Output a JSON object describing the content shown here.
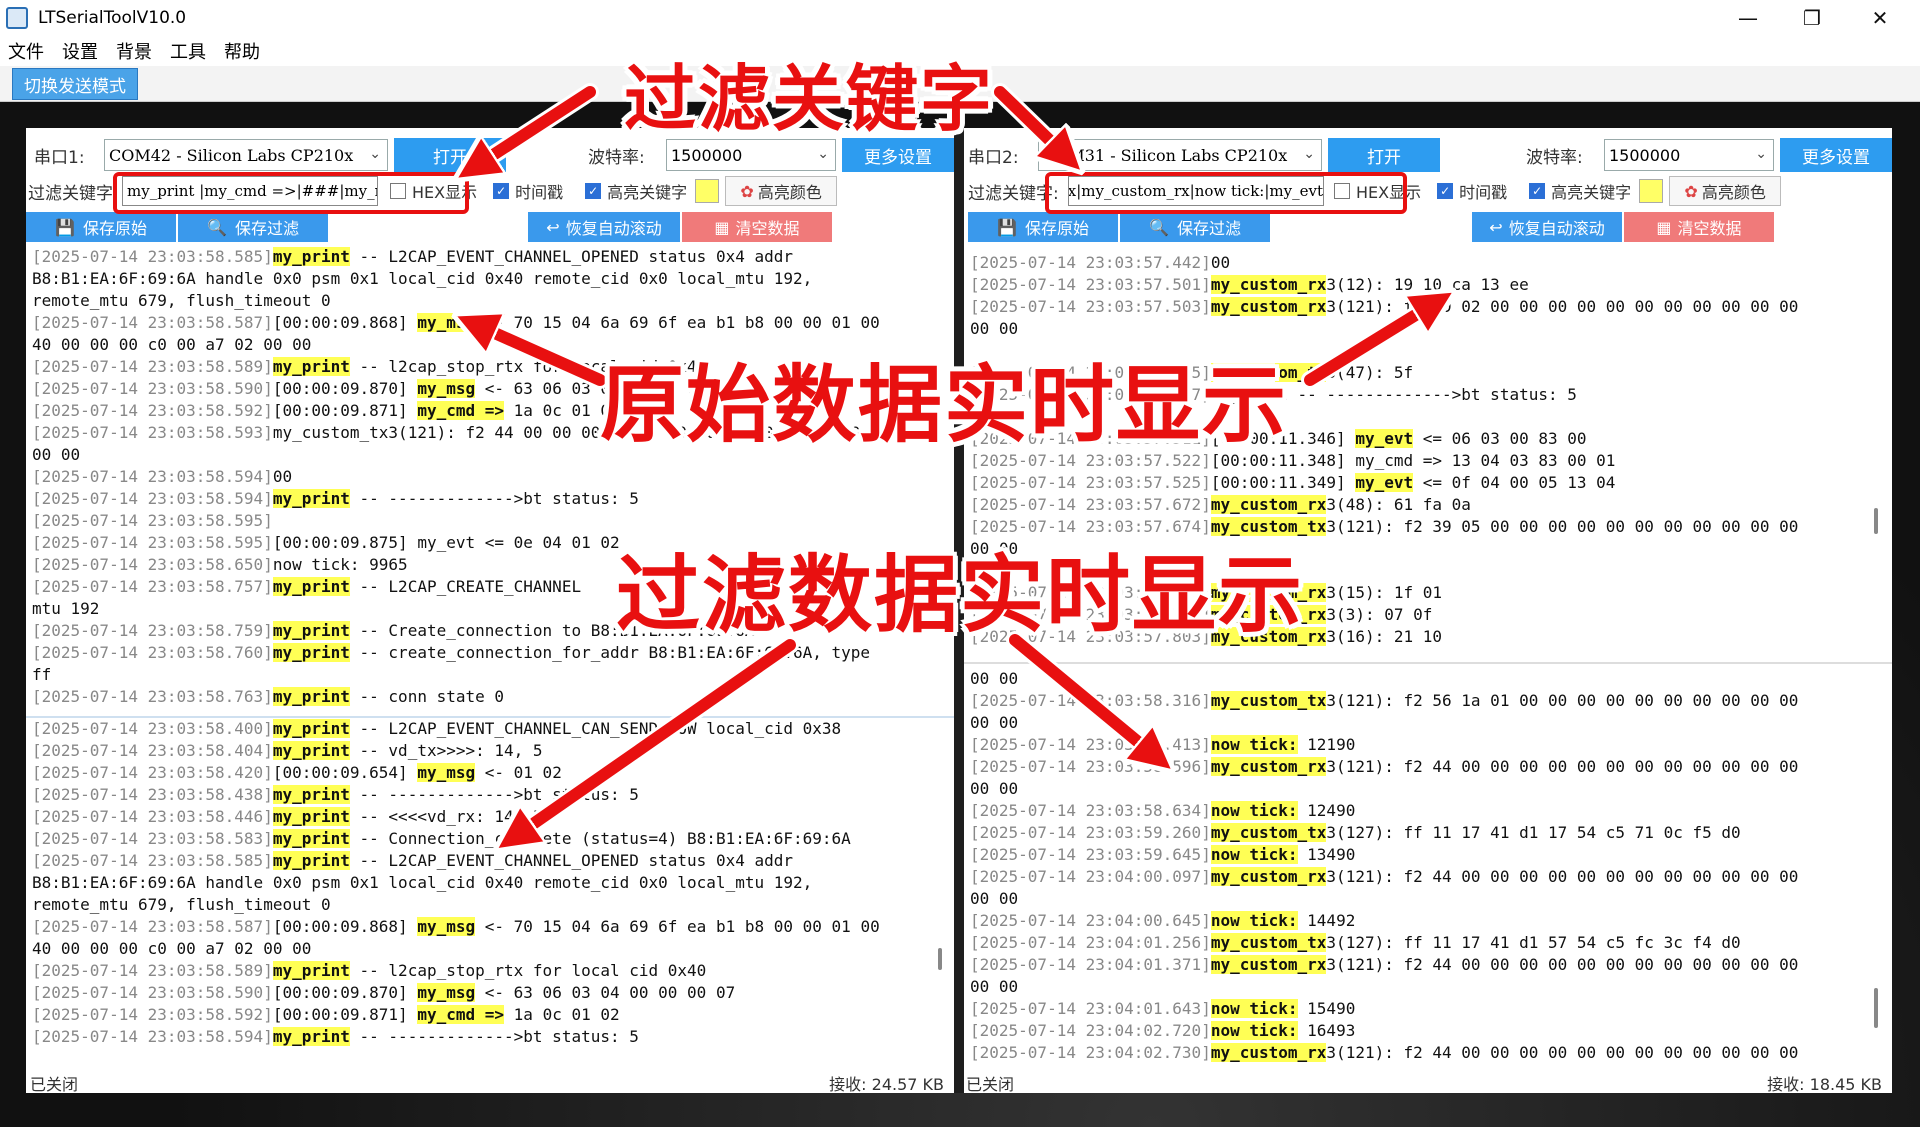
{
  "window": {
    "title": "LTSerialToolV10.0",
    "minimize": "—",
    "maximize": "❐",
    "close": "✕"
  },
  "menu": [
    "文件",
    "设置",
    "背景",
    "工具",
    "帮助"
  ],
  "toolbar": {
    "switch_mode": "切换发送模式"
  },
  "left": {
    "port_label": "串口1:",
    "port_value": "COM42 - Silicon Labs CP210x",
    "open_button": "打开",
    "baud_label": "波特率:",
    "baud_value": "1500000",
    "more_settings": "更多设置",
    "filter_label": "过滤关键字:",
    "filter_value": "my_print |my_cmd =>|###|my_msg",
    "hex_label": "HEX显示",
    "timestamp_label": "时间戳",
    "highlight_label": "高亮关键字",
    "highlight_color_button": "高亮颜色",
    "save_raw": "保存原始",
    "save_filtered": "保存过滤",
    "resume_scroll": "恢复自动滚动",
    "clear_data": "清空数据",
    "status_left": "已关闭",
    "status_right": "接收: 24.57 KB",
    "raw_lines": [
      [
        {
          "t": "[2025-07-14 23:03:58.585]",
          "c": "ts"
        },
        {
          "t": "my_print",
          "c": "hl"
        },
        {
          "t": " -- L2CAP_EVENT_CHANNEL_OPENED status 0x4 addr"
        }
      ],
      [
        {
          "t": "B8:B1:EA:6F:69:6A handle 0x0 psm 0x1 local_cid 0x40 remote_cid 0x0 local_mtu 192,"
        }
      ],
      [
        {
          "t": "remote_mtu 679, flush_timeout 0"
        }
      ],
      [
        {
          "t": "[2025-07-14 23:03:58.587]",
          "c": "ts"
        },
        {
          "t": "[00:00:09.868] "
        },
        {
          "t": "my_msg",
          "c": "hl"
        },
        {
          "t": " <- 70 15 04 6a 69 6f ea b1 b8 00 00 01 00"
        }
      ],
      [
        {
          "t": "40 00 00 00 c0 00 a7 02 00 00"
        }
      ],
      [
        {
          "t": "[2025-07-14 23:03:58.589]",
          "c": "ts"
        },
        {
          "t": "my_print",
          "c": "hl"
        },
        {
          "t": " -- l2cap_stop_rtx for local cid 0x40"
        }
      ],
      [
        {
          "t": "[2025-07-14 23:03:58.590]",
          "c": "ts"
        },
        {
          "t": "[00:00:09.870] "
        },
        {
          "t": "my_msg",
          "c": "hl"
        },
        {
          "t": " <- 63 06 03 04 00 00 00 07"
        }
      ],
      [
        {
          "t": "[2025-07-14 23:03:58.592]",
          "c": "ts"
        },
        {
          "t": "[00:00:09.871] "
        },
        {
          "t": "my_cmd =>",
          "c": "hl"
        },
        {
          "t": " 1a 0c 01 02"
        }
      ],
      [
        {
          "t": "[2025-07-14 23:03:58.593]",
          "c": "ts"
        },
        {
          "t": "my_custom_tx3(121): f2 44 00 00 00 00 00 00 00 00 00 00 00 00"
        }
      ],
      [
        {
          "t": "00 00"
        }
      ],
      [
        {
          "t": "[2025-07-14 23:03:58.594]",
          "c": "ts"
        },
        {
          "t": "00"
        }
      ],
      [
        {
          "t": "[2025-07-14 23:03:58.594]",
          "c": "ts"
        },
        {
          "t": "my_print",
          "c": "hl"
        },
        {
          "t": " -- ------------->bt status: 5"
        }
      ],
      [
        {
          "t": "[2025-07-14 23:03:58.595]",
          "c": "ts"
        }
      ],
      [
        {
          "t": "[2025-07-14 23:03:58.595]",
          "c": "ts"
        },
        {
          "t": "[00:00:09.875] my_evt <= 0e 04 01 02"
        }
      ],
      [
        {
          "t": "[2025-07-14 23:03:58.650]",
          "c": "ts"
        },
        {
          "t": "now tick: 9965"
        }
      ],
      [
        {
          "t": "[2025-07-14 23:03:58.757]",
          "c": "ts"
        },
        {
          "t": "my_print",
          "c": "hl"
        },
        {
          "t": " -- L2CAP_CREATE_CHANNEL"
        }
      ],
      [
        {
          "t": "mtu 192"
        }
      ],
      [
        {
          "t": "[2025-07-14 23:03:58.759]",
          "c": "ts"
        },
        {
          "t": "my_print",
          "c": "hl"
        },
        {
          "t": " -- Create_connection to B8:B1:EA:6F:69:6A"
        }
      ],
      [
        {
          "t": "[2025-07-14 23:03:58.760]",
          "c": "ts"
        },
        {
          "t": "my_print",
          "c": "hl"
        },
        {
          "t": " -- create_connection_for_addr B8:B1:EA:6F:69:6A, type"
        }
      ],
      [
        {
          "t": "ff"
        }
      ],
      [
        {
          "t": "[2025-07-14 23:03:58.763]",
          "c": "ts"
        },
        {
          "t": "my_print",
          "c": "hl"
        },
        {
          "t": " -- conn state 0"
        }
      ]
    ],
    "filtered_lines": [
      [
        {
          "t": "[2025-07-14 23:03:58.400]",
          "c": "ts"
        },
        {
          "t": "my_print",
          "c": "hl"
        },
        {
          "t": " -- L2CAP_EVENT_CHANNEL_CAN_SEND_NOW local_cid 0x38"
        }
      ],
      [
        {
          "t": "[2025-07-14 23:03:58.404]",
          "c": "ts"
        },
        {
          "t": "my_print",
          "c": "hl"
        },
        {
          "t": " -- vd_tx>>>>: 14, 5"
        }
      ],
      [
        {
          "t": "[2025-07-14 23:03:58.420]",
          "c": "ts"
        },
        {
          "t": "[00:00:09.654] "
        },
        {
          "t": "my_msg",
          "c": "hl"
        },
        {
          "t": " <- 01 02"
        }
      ],
      [
        {
          "t": "[2025-07-14 23:03:58.438]",
          "c": "ts"
        },
        {
          "t": "my_print",
          "c": "hl"
        },
        {
          "t": " -- ------------->bt status: 5"
        }
      ],
      [
        {
          "t": "[2025-07-14 23:03:58.446]",
          "c": "ts"
        },
        {
          "t": "my_print",
          "c": "hl"
        },
        {
          "t": " -- <<<<vd_rx: 14, 5"
        }
      ],
      [
        {
          "t": "[2025-07-14 23:03:58.583]",
          "c": "ts"
        },
        {
          "t": "my_print",
          "c": "hl"
        },
        {
          "t": " -- Connection_complete (status=4) B8:B1:EA:6F:69:6A"
        }
      ],
      [
        {
          "t": "[2025-07-14 23:03:58.585]",
          "c": "ts"
        },
        {
          "t": "my_print",
          "c": "hl"
        },
        {
          "t": " -- L2CAP_EVENT_CHANNEL_OPENED status 0x4 addr"
        }
      ],
      [
        {
          "t": "B8:B1:EA:6F:69:6A handle 0x0 psm 0x1 local_cid 0x40 remote_cid 0x0 local_mtu 192,"
        }
      ],
      [
        {
          "t": "remote_mtu 679, flush_timeout 0"
        }
      ],
      [
        {
          "t": "[2025-07-14 23:03:58.587]",
          "c": "ts"
        },
        {
          "t": "[00:00:09.868] "
        },
        {
          "t": "my_msg",
          "c": "hl"
        },
        {
          "t": " <- 70 15 04 6a 69 6f ea b1 b8 00 00 01 00"
        }
      ],
      [
        {
          "t": "40 00 00 00 c0 00 a7 02 00 00"
        }
      ],
      [
        {
          "t": "[2025-07-14 23:03:58.589]",
          "c": "ts"
        },
        {
          "t": "my_print",
          "c": "hl"
        },
        {
          "t": " -- l2cap_stop_rtx for local cid 0x40"
        }
      ],
      [
        {
          "t": "[2025-07-14 23:03:58.590]",
          "c": "ts"
        },
        {
          "t": "[00:00:09.870] "
        },
        {
          "t": "my_msg",
          "c": "hl"
        },
        {
          "t": " <- 63 06 03 04 00 00 00 07"
        }
      ],
      [
        {
          "t": "[2025-07-14 23:03:58.592]",
          "c": "ts"
        },
        {
          "t": "[00:00:09.871] "
        },
        {
          "t": "my_cmd =>",
          "c": "hl"
        },
        {
          "t": " 1a 0c 01 02"
        }
      ],
      [
        {
          "t": "[2025-07-14 23:03:58.594]",
          "c": "ts"
        },
        {
          "t": "my_print",
          "c": "hl"
        },
        {
          "t": " -- ------------->bt status: 5"
        }
      ]
    ]
  },
  "right": {
    "port_label": "串口2:",
    "port_value": "COM31 - Silicon Labs CP210x",
    "open_button": "打开",
    "baud_label": "波特率:",
    "baud_value": "1500000",
    "more_settings": "更多设置",
    "filter_label": "过滤关键字:",
    "filter_value": "my_custom_tx|my_custom_rx|now tick:|my_evt",
    "hex_label": "HEX显示",
    "timestamp_label": "时间戳",
    "highlight_label": "高亮关键字",
    "highlight_color_button": "高亮颜色",
    "save_raw": "保存原始",
    "save_filtered": "保存过滤",
    "resume_scroll": "恢复自动滚动",
    "clear_data": "清空数据",
    "status_left": "已关闭",
    "status_right": "接收: 18.45 KB",
    "raw_lines": [
      [
        {
          "t": "[2025-07-14 23:03:57.442]",
          "c": "ts"
        },
        {
          "t": "00"
        }
      ],
      [
        {
          "t": "[2025-07-14 23:03:57.501]",
          "c": "ts"
        },
        {
          "t": "my_custom_rx",
          "c": "hl"
        },
        {
          "t": "3(12): 19 10 ca 13 ee"
        }
      ],
      [
        {
          "t": "[2025-07-14 23:03:57.503]",
          "c": "ts"
        },
        {
          "t": "my_custom_rx",
          "c": "hl"
        },
        {
          "t": "3(121): f2 39 02 00 00 00 00 00 00 00 00 00 00 00"
        }
      ],
      [
        {
          "t": "00 00"
        }
      ],
      [
        {
          "t": ""
        }
      ],
      [
        {
          "t": "[2025-07-14 23:03:57.505]",
          "c": "ts"
        },
        {
          "t": "my_custom_tx",
          "c": "hl"
        },
        {
          "t": "3(47): 5f"
        }
      ],
      [
        {
          "t": "[2025-07-14 23:03:57.507]",
          "c": "ts"
        },
        {
          "t": "my_print -- ------------->bt status: 5"
        }
      ],
      [
        {
          "t": ""
        }
      ],
      [
        {
          "t": "[2025-07-14 23:03:57.511]",
          "c": "ts"
        },
        {
          "t": "[00:00:11.346] "
        },
        {
          "t": "my_evt",
          "c": "hl"
        },
        {
          "t": " <= 06 03 00 83 00"
        }
      ],
      [
        {
          "t": "[2025-07-14 23:03:57.522]",
          "c": "ts"
        },
        {
          "t": "[00:00:11.348] my_cmd => 13 04 03 83 00 01"
        }
      ],
      [
        {
          "t": "[2025-07-14 23:03:57.525]",
          "c": "ts"
        },
        {
          "t": "[00:00:11.349] "
        },
        {
          "t": "my_evt",
          "c": "hl"
        },
        {
          "t": " <= 0f 04 00 05 13 04"
        }
      ],
      [
        {
          "t": "[2025-07-14 23:03:57.672]",
          "c": "ts"
        },
        {
          "t": "my_custom_rx",
          "c": "hl"
        },
        {
          "t": "3(48): 61 fa 0a"
        }
      ],
      [
        {
          "t": "[2025-07-14 23:03:57.674]",
          "c": "ts"
        },
        {
          "t": "my_custom_tx",
          "c": "hl"
        },
        {
          "t": "3(121): f2 39 05 00 00 00 00 00 00 00 00 00 00 00"
        }
      ],
      [
        {
          "t": "00 00"
        }
      ],
      [
        {
          "t": ""
        }
      ],
      [
        {
          "t": "[2025-07-14 23:03:57.790]",
          "c": "ts"
        },
        {
          "t": "my_custom_rx",
          "c": "hl"
        },
        {
          "t": "3(15): 1f 01"
        }
      ],
      [
        {
          "t": "[2025-07-14 23:03:57.795]",
          "c": "ts"
        },
        {
          "t": "my_custom_rx",
          "c": "hl"
        },
        {
          "t": "3(3): 07 0f"
        }
      ],
      [
        {
          "t": "[2025-07-14 23:03:57.803]",
          "c": "ts"
        },
        {
          "t": "my_custom_rx",
          "c": "hl"
        },
        {
          "t": "3(16): 21 10"
        }
      ]
    ],
    "filtered_lines": [
      [
        {
          "t": "00 00"
        }
      ],
      [
        {
          "t": "[2025-07-14 23:03:58.316]",
          "c": "ts"
        },
        {
          "t": "my_custom_tx",
          "c": "hl"
        },
        {
          "t": "3(121): f2 56 1a 01 00 00 00 00 00 00 00 00 00 00"
        }
      ],
      [
        {
          "t": "00 00"
        }
      ],
      [
        {
          "t": "[2025-07-14 23:03:58.413]",
          "c": "ts"
        },
        {
          "t": "now tick:",
          "c": "hl"
        },
        {
          "t": " 12190"
        }
      ],
      [
        {
          "t": "[2025-07-14 23:03:58.596]",
          "c": "ts"
        },
        {
          "t": "my_custom_rx",
          "c": "hl"
        },
        {
          "t": "3(121): f2 44 00 00 00 00 00 00 00 00 00 00 00 00"
        }
      ],
      [
        {
          "t": "00 00"
        }
      ],
      [
        {
          "t": "[2025-07-14 23:03:58.634]",
          "c": "ts"
        },
        {
          "t": "now tick:",
          "c": "hl"
        },
        {
          "t": " 12490"
        }
      ],
      [
        {
          "t": "[2025-07-14 23:03:59.260]",
          "c": "ts"
        },
        {
          "t": "my_custom_tx",
          "c": "hl"
        },
        {
          "t": "3(127): ff 11 17 41 d1 17 54 c5 71 0c f5 d0"
        }
      ],
      [
        {
          "t": "[2025-07-14 23:03:59.645]",
          "c": "ts"
        },
        {
          "t": "now tick:",
          "c": "hl"
        },
        {
          "t": " 13490"
        }
      ],
      [
        {
          "t": "[2025-07-14 23:04:00.097]",
          "c": "ts"
        },
        {
          "t": "my_custom_rx",
          "c": "hl"
        },
        {
          "t": "3(121): f2 44 00 00 00 00 00 00 00 00 00 00 00 00"
        }
      ],
      [
        {
          "t": "00 00"
        }
      ],
      [
        {
          "t": "[2025-07-14 23:04:00.645]",
          "c": "ts"
        },
        {
          "t": "now tick:",
          "c": "hl"
        },
        {
          "t": " 14492"
        }
      ],
      [
        {
          "t": "[2025-07-14 23:04:01.256]",
          "c": "ts"
        },
        {
          "t": "my_custom_tx",
          "c": "hl"
        },
        {
          "t": "3(127): ff 11 17 41 d1 57 54 c5 fc 3c f4 d0"
        }
      ],
      [
        {
          "t": "[2025-07-14 23:04:01.371]",
          "c": "ts"
        },
        {
          "t": "my_custom_rx",
          "c": "hl"
        },
        {
          "t": "3(121): f2 44 00 00 00 00 00 00 00 00 00 00 00 00"
        }
      ],
      [
        {
          "t": "00 00"
        }
      ],
      [
        {
          "t": "[2025-07-14 23:04:01.643]",
          "c": "ts"
        },
        {
          "t": "now tick:",
          "c": "hl"
        },
        {
          "t": " 15490"
        }
      ],
      [
        {
          "t": "[2025-07-14 23:04:02.720]",
          "c": "ts"
        },
        {
          "t": "now tick:",
          "c": "hl"
        },
        {
          "t": " 16493"
        }
      ],
      [
        {
          "t": "[2025-07-14 23:04:02.730]",
          "c": "ts"
        },
        {
          "t": "my_custom_rx",
          "c": "hl"
        },
        {
          "t": "3(121): f2 44 00 00 00 00 00 00 00 00 00 00 00 00"
        }
      ]
    ]
  },
  "annotations": {
    "filter_keyword": "过滤关键字",
    "raw_realtime": "原始数据实时显示",
    "filtered_realtime": "过滤数据实时显示"
  },
  "colors": {
    "accent_blue": "#2d9cf0",
    "highlight_yellow": "#ffff55",
    "annotation_red": "#e81010",
    "clear_red": "#f07a7a"
  }
}
